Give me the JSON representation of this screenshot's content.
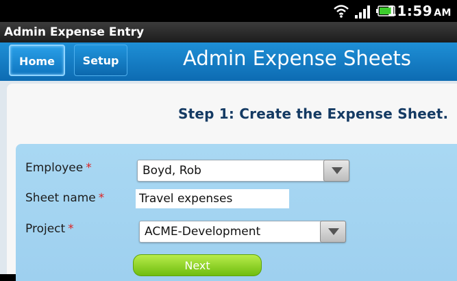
{
  "status_bar": {
    "time": "11:59",
    "ampm": "AM",
    "icons": [
      "wifi-icon",
      "signal-icon",
      "battery-icon"
    ]
  },
  "window": {
    "title": "Admin Expense Entry"
  },
  "nav": {
    "home_label": "Home",
    "setup_label": "Setup",
    "page_title": "Admin Expense Sheets"
  },
  "content": {
    "step_title": "Step 1: Create the Expense Sheet."
  },
  "form": {
    "employee": {
      "label": "Employee",
      "required_mark": "*",
      "value": "Boyd, Rob"
    },
    "sheet_name": {
      "label": "Sheet name",
      "required_mark": "*",
      "value": "Travel expenses"
    },
    "project": {
      "label": "Project",
      "required_mark": "*",
      "value": "ACME-Development"
    },
    "next_label": "Next"
  },
  "colors": {
    "nav_blue": "#1e8fd6",
    "title_text": "#143a63",
    "required": "#dd2222",
    "form_panel": "#a9d8f3",
    "next_green": "#8fd82a"
  }
}
